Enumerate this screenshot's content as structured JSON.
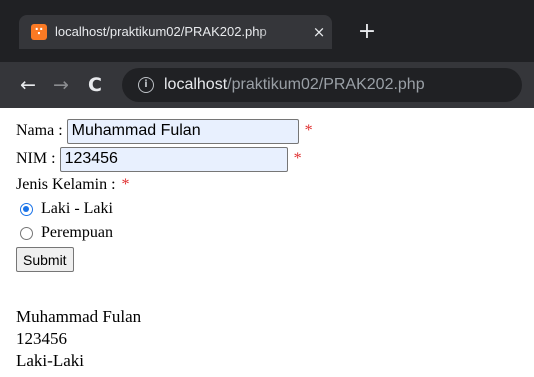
{
  "browser": {
    "tab_title": "localhost/praktikum02/PRAK202.php",
    "tab_favicon": "xampp-icon",
    "tab_close": "×",
    "new_tab": "+",
    "nav_back": "←",
    "nav_forward": "→",
    "nav_reload": "C",
    "address_info_icon": "i",
    "url_host": "localhost",
    "url_path": "/praktikum02/PRAK202.php"
  },
  "form": {
    "nama_label": "Nama :",
    "nama_value": "Muhammad Fulan",
    "nim_label": "NIM :",
    "nim_value": "123456",
    "required_mark": "*",
    "jenis_kelamin_label": "Jenis Kelamin :",
    "options": [
      {
        "label": "Laki - Laki",
        "checked": true
      },
      {
        "label": "Perempuan",
        "checked": false
      }
    ],
    "submit_label": "Submit"
  },
  "output": {
    "nama": "Muhammad Fulan",
    "nim": "123456",
    "jenis_kelamin": "Laki-Laki"
  },
  "colors": {
    "required": "#e03030",
    "radio_checked": "#1a73e8",
    "chrome_bg": "#202124",
    "toolbar_bg": "#35363a"
  }
}
